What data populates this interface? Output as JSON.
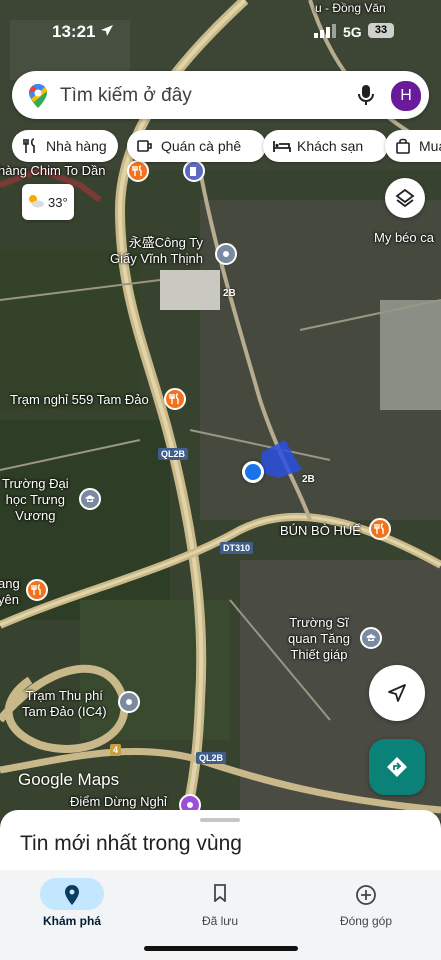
{
  "status_bar": {
    "time": "13:21",
    "network": "5G",
    "battery": "33"
  },
  "search": {
    "placeholder": "Tìm kiếm ở đây",
    "avatar_letter": "H"
  },
  "chips": [
    {
      "label": "Nhà hàng",
      "icon": "fork-knife-icon"
    },
    {
      "label": "Quán cà phê",
      "icon": "coffee-cup-icon"
    },
    {
      "label": "Khách sạn",
      "icon": "bed-icon"
    },
    {
      "label": "Mua",
      "icon": "shopping-bag-icon"
    }
  ],
  "weather": {
    "temperature": "33°",
    "icon": "partly-sunny-icon"
  },
  "map": {
    "top_road_label": "u - Đồng Văn",
    "places": [
      {
        "name": "hàng Chim To Dần",
        "icon": "restaurant-marker"
      },
      {
        "name": "My béo ca",
        "icon": "none"
      },
      {
        "name": "永盛Công Ty\nGiấy Vĩnh Thịnh",
        "icon": "grey-place-marker"
      },
      {
        "name": "Trạm nghỉ 559 Tam Đảo",
        "icon": "restaurant-marker"
      },
      {
        "name": "Trường Đại\nhọc Trưng\nVương",
        "icon": "school-marker"
      },
      {
        "name": "BÚN BÒ HUẾ",
        "icon": "restaurant-marker"
      },
      {
        "name": "ang\nyên",
        "icon": "restaurant-marker"
      },
      {
        "name": "Trường Sĩ\nquan Tăng\nThiết giáp",
        "icon": "school-marker"
      },
      {
        "name": "Trạm Thu phí\nTam Đảo (IC4)",
        "icon": "grey-place-marker"
      },
      {
        "name": "Điểm Dừng Nghỉ",
        "icon": "purple-marker"
      }
    ],
    "roads": [
      "2B",
      "QL2B",
      "2B",
      "DT310",
      "4",
      "QL2B"
    ],
    "brand": "Google Maps",
    "colors": {
      "restaurant": "#f2731b",
      "school": "#7a8aa0",
      "location": "#1a73e8",
      "directions": "#0b8278"
    }
  },
  "sheet": {
    "title": "Tin mới nhất trong vùng"
  },
  "bottom_nav": [
    {
      "label": "Khám phá",
      "icon": "location-pin-icon",
      "active": true
    },
    {
      "label": "Đã lưu",
      "icon": "bookmark-icon",
      "active": false
    },
    {
      "label": "Đóng góp",
      "icon": "add-circle-icon",
      "active": false
    }
  ]
}
